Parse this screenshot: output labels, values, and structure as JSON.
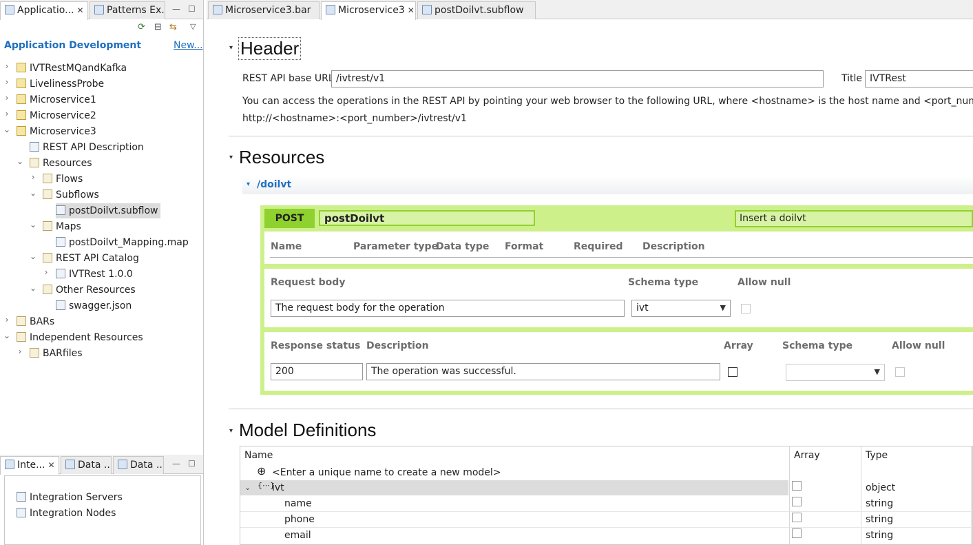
{
  "left_tabs": {
    "tab1": "Applicatio...",
    "tab2": "Patterns Ex...",
    "header_title": "Application Development",
    "new_link": "New..."
  },
  "tree": [
    {
      "label": "IVTRestMQandKafka"
    },
    {
      "label": "LivelinessProbe"
    },
    {
      "label": "Microservice1"
    },
    {
      "label": "Microservice2"
    },
    {
      "label": "Microservice3"
    },
    {
      "label": "REST API Description"
    },
    {
      "label": "Resources"
    },
    {
      "label": "Flows"
    },
    {
      "label": "Subflows"
    },
    {
      "label": "postDoilvt.subflow"
    },
    {
      "label": "Maps"
    },
    {
      "label": "postDoilvt_Mapping.map"
    },
    {
      "label": "REST API Catalog"
    },
    {
      "label": "IVTRest 1.0.0"
    },
    {
      "label": "Other Resources"
    },
    {
      "label": "swagger.json"
    },
    {
      "label": "BARs"
    },
    {
      "label": "Independent Resources"
    },
    {
      "label": "BARfiles"
    }
  ],
  "bottom_tabs": {
    "tab1": "Inte...",
    "tab2": "Data ...",
    "tab3": "Data ...",
    "item1": "Integration Servers",
    "item2": "Integration Nodes"
  },
  "editor_tabs": {
    "tab1": "Microservice3.bar",
    "tab2": "Microservice3",
    "tab3": "postDoilvt.subflow"
  },
  "header": {
    "title": "Header",
    "base_url_label": "REST API base URL",
    "base_url_value": "/ivtrest/v1",
    "title_label": "Title",
    "title_value": "IVTRest",
    "info": "You can access the operations in the REST API by pointing your web browser to the following URL, where <hostname> is the host name and <port_number> is the",
    "url": "http://<hostname>:<port_number>/ivtrest/v1"
  },
  "resources": {
    "title": "Resources",
    "path": "/doilvt",
    "method": "POST",
    "op_name": "postDoilvt",
    "op_desc": "Insert a doilvt",
    "param_headers": [
      "Name",
      "Parameter type",
      "Data type",
      "Format",
      "Required",
      "Description"
    ],
    "request_body_label": "Request body",
    "schema_type_label": "Schema type",
    "allow_null_label": "Allow null",
    "request_body_value": "The request body for the operation",
    "schema_value": "ivt",
    "response_status_label": "Response status",
    "description_label": "Description",
    "array_label": "Array",
    "response_status_value": "200",
    "response_desc_value": "The operation was successful."
  },
  "models": {
    "title": "Model Definitions",
    "col_name": "Name",
    "col_array": "Array",
    "col_type": "Type",
    "new_model_hint": "<Enter a unique name to create a new model>",
    "rows": [
      {
        "name": "ivt",
        "type": "object"
      },
      {
        "name": "name",
        "type": "string"
      },
      {
        "name": "phone",
        "type": "string"
      },
      {
        "name": "email",
        "type": "string"
      }
    ]
  },
  "colors": {
    "accent_green": "#cdf08a",
    "post_green": "#8fd12e",
    "link_blue": "#1f6fbf"
  }
}
